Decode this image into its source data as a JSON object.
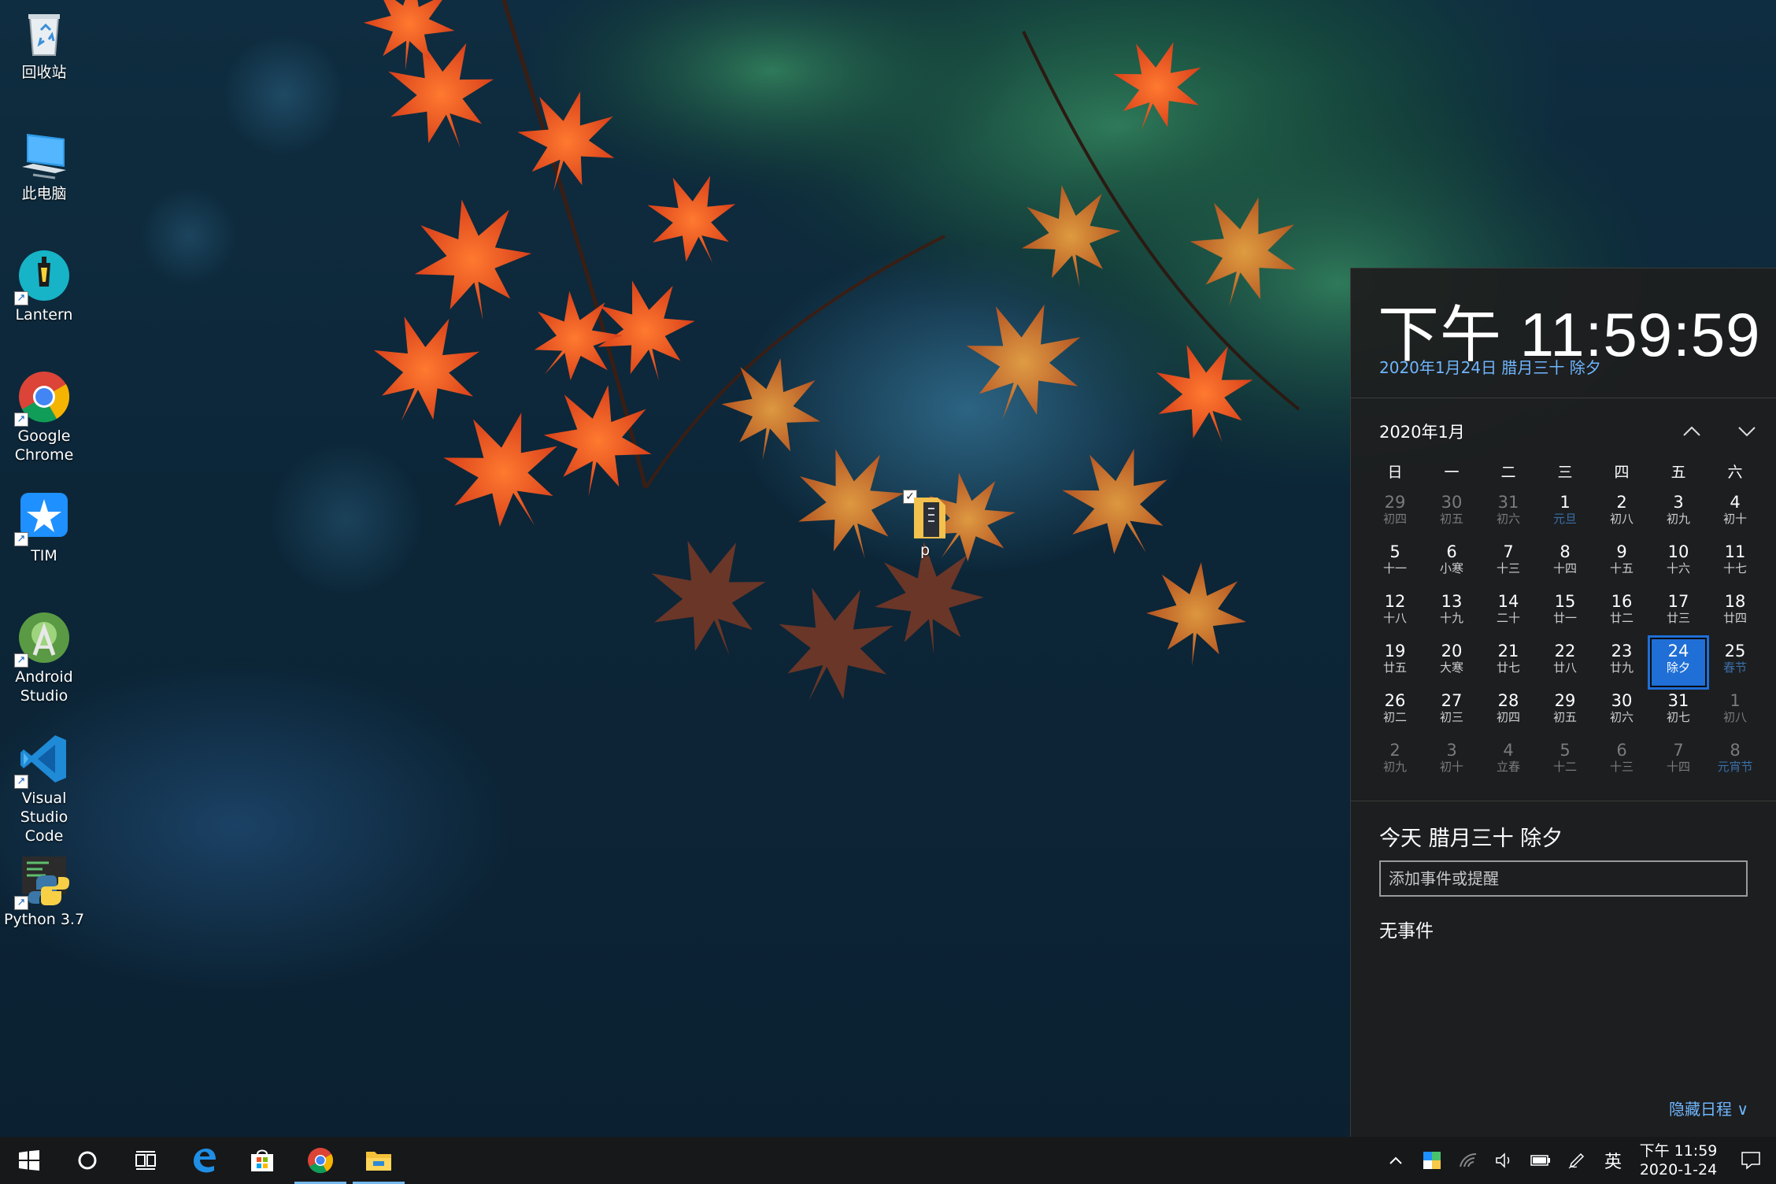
{
  "desktop": {
    "icons": [
      {
        "label": "回收站"
      },
      {
        "label": "此电脑"
      },
      {
        "label": "Lantern"
      },
      {
        "label": "Google\nChrome"
      },
      {
        "label": "TIM"
      },
      {
        "label": "Android\nStudio"
      },
      {
        "label": "Visual\nStudio Code"
      },
      {
        "label": "Python 3.7"
      }
    ],
    "file": {
      "label": "p"
    }
  },
  "flyout": {
    "time": "下午 11:59:59",
    "date": "2020年1月24日 腊月三十 除夕",
    "month_title": "2020年1月",
    "weekdays": [
      "日",
      "一",
      "二",
      "三",
      "四",
      "五",
      "六"
    ],
    "weeks": [
      [
        {
          "d": "29",
          "l": "初四",
          "dim": true
        },
        {
          "d": "30",
          "l": "初五",
          "dim": true
        },
        {
          "d": "31",
          "l": "初六",
          "dim": true
        },
        {
          "d": "1",
          "l": "元旦",
          "hol": true
        },
        {
          "d": "2",
          "l": "初八"
        },
        {
          "d": "3",
          "l": "初九"
        },
        {
          "d": "4",
          "l": "初十"
        }
      ],
      [
        {
          "d": "5",
          "l": "十一"
        },
        {
          "d": "6",
          "l": "小寒"
        },
        {
          "d": "7",
          "l": "十三"
        },
        {
          "d": "8",
          "l": "十四"
        },
        {
          "d": "9",
          "l": "十五"
        },
        {
          "d": "10",
          "l": "十六"
        },
        {
          "d": "11",
          "l": "十七"
        }
      ],
      [
        {
          "d": "12",
          "l": "十八"
        },
        {
          "d": "13",
          "l": "十九"
        },
        {
          "d": "14",
          "l": "二十"
        },
        {
          "d": "15",
          "l": "廿一"
        },
        {
          "d": "16",
          "l": "廿二"
        },
        {
          "d": "17",
          "l": "廿三"
        },
        {
          "d": "18",
          "l": "廿四"
        }
      ],
      [
        {
          "d": "19",
          "l": "廿五"
        },
        {
          "d": "20",
          "l": "大寒"
        },
        {
          "d": "21",
          "l": "廿七"
        },
        {
          "d": "22",
          "l": "廿八"
        },
        {
          "d": "23",
          "l": "廿九"
        },
        {
          "d": "24",
          "l": "除夕",
          "today": true
        },
        {
          "d": "25",
          "l": "春节",
          "hol": true
        }
      ],
      [
        {
          "d": "26",
          "l": "初二"
        },
        {
          "d": "27",
          "l": "初三"
        },
        {
          "d": "28",
          "l": "初四"
        },
        {
          "d": "29",
          "l": "初五"
        },
        {
          "d": "30",
          "l": "初六"
        },
        {
          "d": "31",
          "l": "初七"
        },
        {
          "d": "1",
          "l": "初八",
          "dim": true
        }
      ],
      [
        {
          "d": "2",
          "l": "初九",
          "dim": true
        },
        {
          "d": "3",
          "l": "初十",
          "dim": true
        },
        {
          "d": "4",
          "l": "立春",
          "dim": true
        },
        {
          "d": "5",
          "l": "十二",
          "dim": true
        },
        {
          "d": "6",
          "l": "十三",
          "dim": true
        },
        {
          "d": "7",
          "l": "十四",
          "dim": true
        },
        {
          "d": "8",
          "l": "元宵节",
          "dim": true,
          "hol": true
        }
      ]
    ],
    "today_label": "今天 腊月三十 除夕",
    "event_placeholder": "添加事件或提醒",
    "no_events": "无事件",
    "hide_schedule": "隐藏日程 ∨"
  },
  "taskbar": {
    "apps": [
      "start-icon",
      "cortana-icon",
      "task-view-icon",
      "edge-icon",
      "store-icon",
      "chrome-icon",
      "file-explorer-icon"
    ],
    "running": [
      "chrome-icon",
      "file-explorer-icon"
    ],
    "tray": {
      "input_method": "英",
      "clock_time": "下午 11:59",
      "clock_date": "2020-1-24"
    }
  },
  "colors": {
    "accent": "#1f6fd6",
    "link": "#6fb6ff",
    "flyout_bg": "#1e1e1e",
    "taskbar_bg": "#17181a"
  }
}
